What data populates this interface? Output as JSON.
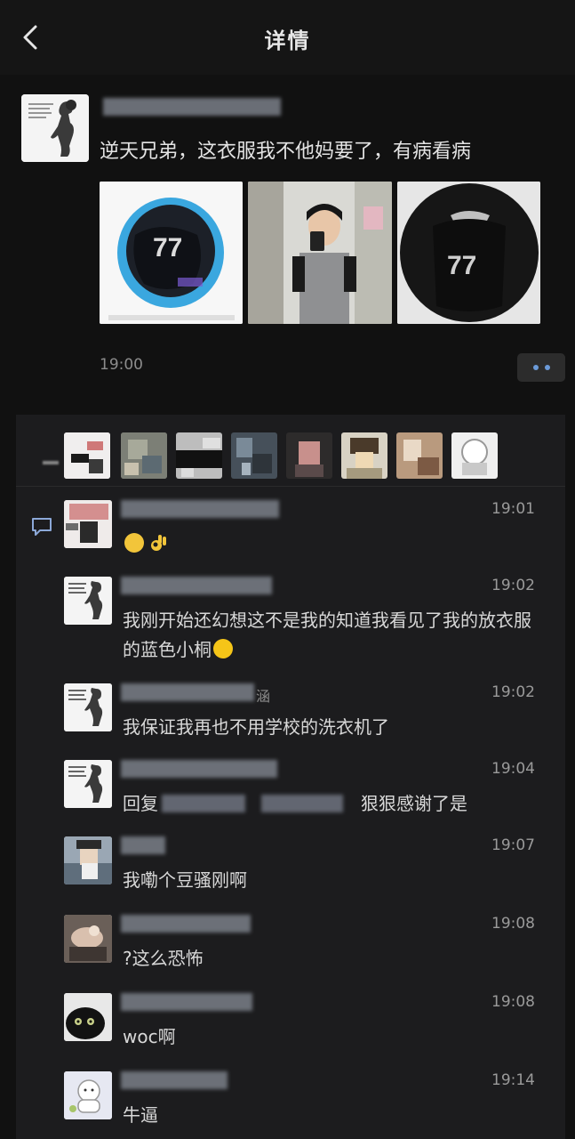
{
  "header": {
    "title": "详情"
  },
  "post": {
    "text": "逆天兄弟，这衣服我不他妈要了，有病看病",
    "time": "19:00",
    "photos": [
      {
        "jersey_number": "77"
      },
      {
        "jersey_number": ""
      },
      {
        "jersey_number": "77"
      }
    ]
  },
  "comments": [
    {
      "time": "19:01",
      "text": ""
    },
    {
      "time": "19:02",
      "text": "我刚开始还幻想这不是我的知道我看见了我的放衣服的蓝色小桐"
    },
    {
      "time": "19:02",
      "name_suffix": "涵",
      "text": "我保证我再也不用学校的洗衣机了"
    },
    {
      "time": "19:04",
      "text_prefix": "回复",
      "text_suffix": "狠狠感谢了是"
    },
    {
      "time": "19:07",
      "text": "我嘞个豆骚刚啊"
    },
    {
      "time": "19:08",
      "text": "?这么恐怖"
    },
    {
      "time": "19:08",
      "text": "woc啊"
    },
    {
      "time": "19:14",
      "text": "牛逼"
    }
  ],
  "colors": {
    "background": "#111111",
    "panel": "#1c1c1e",
    "text": "#d8d8d8",
    "time": "#9a9a9a",
    "accent": "#6b9ad8"
  },
  "icons": [
    "back-arrow-icon",
    "more-dots-icon",
    "comment-icon",
    "laughing-crying-emoji",
    "ok-hand-emoji",
    "smile-emoji"
  ]
}
